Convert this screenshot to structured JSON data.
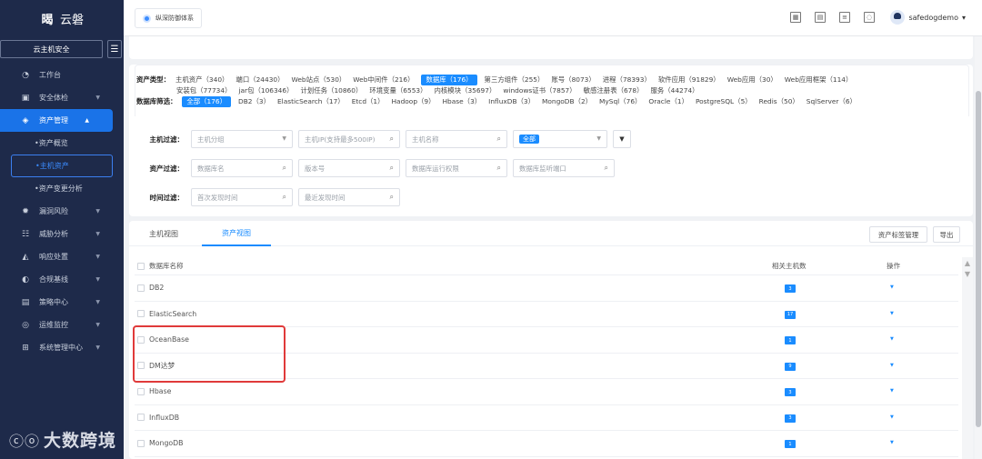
{
  "app": {
    "logo_text": "云磐",
    "logo_mark": "暍"
  },
  "sidebar": {
    "section_button": "云主机安全",
    "collapse_icon": "menu-fold-icon",
    "items": [
      {
        "label": "工作台",
        "icon": "dashboard-icon",
        "glyph": "◔"
      },
      {
        "label": "安全体检",
        "icon": "checkup-icon",
        "glyph": "▣"
      },
      {
        "label": "资产管理",
        "icon": "asset-icon",
        "glyph": "◈"
      },
      {
        "label": "漏洞风险",
        "icon": "bug-icon",
        "glyph": "✹"
      },
      {
        "label": "威胁分析",
        "icon": "threat-icon",
        "glyph": "☷"
      },
      {
        "label": "响应处置",
        "icon": "response-icon",
        "glyph": "◭"
      },
      {
        "label": "合规基线",
        "icon": "baseline-icon",
        "glyph": "◐"
      },
      {
        "label": "策略中心",
        "icon": "policy-icon",
        "glyph": "▤"
      },
      {
        "label": "运维监控",
        "icon": "monitor-icon",
        "glyph": "◎"
      },
      {
        "label": "系统管理中心",
        "icon": "system-icon",
        "glyph": "⊞"
      }
    ],
    "subitems": [
      "资产概览",
      "主机资产",
      "资产变更分析"
    ]
  },
  "watermark": {
    "logo": "ⓒⓞ",
    "text": "大数跨境"
  },
  "topbar": {
    "brand": "纵深防御体系",
    "icons": [
      "grid-icon",
      "apps-icon",
      "clipboard-icon",
      "notification-icon"
    ],
    "username": "safedogdemo",
    "user_dropdown": "▾"
  },
  "types": {
    "asset_label": "资产类型：",
    "asset_types": [
      "主机资产（340）",
      "端口（24430）",
      "Web站点（530）",
      "Web中间件（216）",
      "数据库（176）",
      "第三方组件（255）",
      "账号（8073）",
      "进程（78393）",
      "软件应用（91829）",
      "Web应用（30）",
      "Web应用框架（114）",
      "安装包（77734）",
      "jar包（106346）",
      "计划任务（10860）",
      "环境变量（6553）",
      "内核模块（35697）",
      "windows证书（7857）",
      "敏感注册表（678）",
      "服务（44274）"
    ],
    "db_label": "数据库筛选：",
    "db_filters": [
      "全部（176）",
      "DB2（3）",
      "ElasticSearch（17）",
      "Etcd（1）",
      "Hadoop（9）",
      "Hbase（3）",
      "InfluxDB（3）",
      "MongoDB（2）",
      "MySql（76）",
      "Oracle（1）",
      "PostgreSQL（5）",
      "Redis（50）",
      "SqlServer（6）"
    ]
  },
  "filters": {
    "host_label": "主机过滤：",
    "host_group_placeholder": "主机分组",
    "host_ip_placeholder": "主机IP(支持最多500IP)",
    "host_name_placeholder": "主机名称",
    "all_tag": "全部",
    "asset_label": "资产过滤：",
    "db_name_placeholder": "数据库名",
    "version_placeholder": "版本号",
    "run_perm_placeholder": "数据库运行权限",
    "listen_port_placeholder": "数据库监听端口",
    "time_label": "时间过滤：",
    "first_found_placeholder": "首次发现时间",
    "last_found_placeholder": "最近发现时间"
  },
  "table": {
    "tabs": [
      "主机视图",
      "资产视图"
    ],
    "tag_manage": "资产标签管理",
    "export": "导出",
    "headers": {
      "name": "数据库名称",
      "count": "相关主机数",
      "op": "操作"
    },
    "rows": [
      {
        "name": "DB2",
        "count": "3"
      },
      {
        "name": "ElasticSearch",
        "count": "17"
      },
      {
        "name": "OceanBase",
        "count": "1"
      },
      {
        "name": "DM达梦",
        "count": "9"
      },
      {
        "name": "Hbase",
        "count": "3"
      },
      {
        "name": "InfluxDB",
        "count": "3"
      },
      {
        "name": "MongoDB",
        "count": "1"
      }
    ],
    "op_symbol": "▼"
  }
}
